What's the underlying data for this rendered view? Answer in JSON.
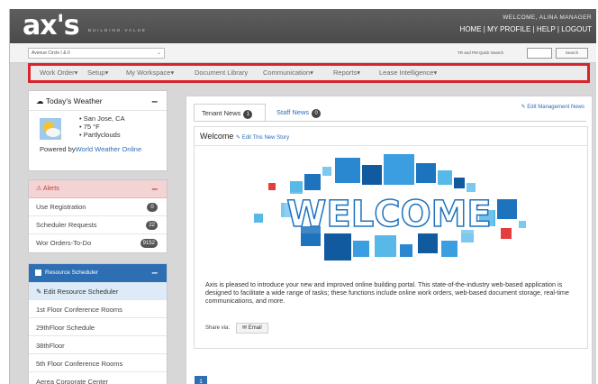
{
  "header": {
    "logo": "ax's",
    "tagline": "BUILDING VALUE",
    "welcome": "WELCOME, ALINA MANAGER",
    "links": [
      "HOME",
      "MY PROFILE",
      "HELP",
      "LOGOUT"
    ]
  },
  "subbar": {
    "property": "Avenue Circle I & II",
    "quick_search_label": "TR and PM Quick Search",
    "search_button": "Search"
  },
  "nav": [
    "Work Order",
    "Setup",
    "My Workspace",
    "Document Library",
    "Communication",
    "Reports",
    "Lease Intelligence"
  ],
  "weather": {
    "title": "Today's Weather",
    "items": [
      "San Jose, CA",
      "75 °F",
      "Partlyclouds"
    ],
    "powered_prefix": "Powered by",
    "powered_link": "World Weather Online"
  },
  "alerts": {
    "title": "Alerts",
    "rows": [
      {
        "label": "Use Registration",
        "count": "0"
      },
      {
        "label": "Scheduler Requests",
        "count": "22"
      },
      {
        "label": "Wor Orders-To-Do",
        "count": "9152"
      }
    ]
  },
  "resource_scheduler": {
    "title": "Resource Scheduler",
    "rows": [
      "Edit Resource Scheduler",
      "1st Floor Conference Rooms",
      "29thFloor Schedule",
      "38thFloor",
      "5th Floor Conference Rooms",
      "Aerea Corporate Center"
    ]
  },
  "tabs": [
    {
      "label": "Tenant News",
      "count": "1"
    },
    {
      "label": "Staff News",
      "count": "0"
    }
  ],
  "edit_management_news": "Edit Management News",
  "story": {
    "title": "Welcome",
    "edit_link": "Edit This New Story",
    "banner_text": "WELCOME",
    "body": "Axis is pleased to introduce your new and improved online building portal. This state-of-the-industry web-based application is designed to facilitate a wide range of tasks; these functions include online work orders, web-based document storage, real-time communications, and more.",
    "share_label": "Share via:",
    "email_button": "Email"
  },
  "pagination": {
    "current_page": "1"
  },
  "colors": {
    "nav_highlight": "#d8242b",
    "accent_blue": "#2e6fb3",
    "alert_red": "#c23b3b"
  }
}
